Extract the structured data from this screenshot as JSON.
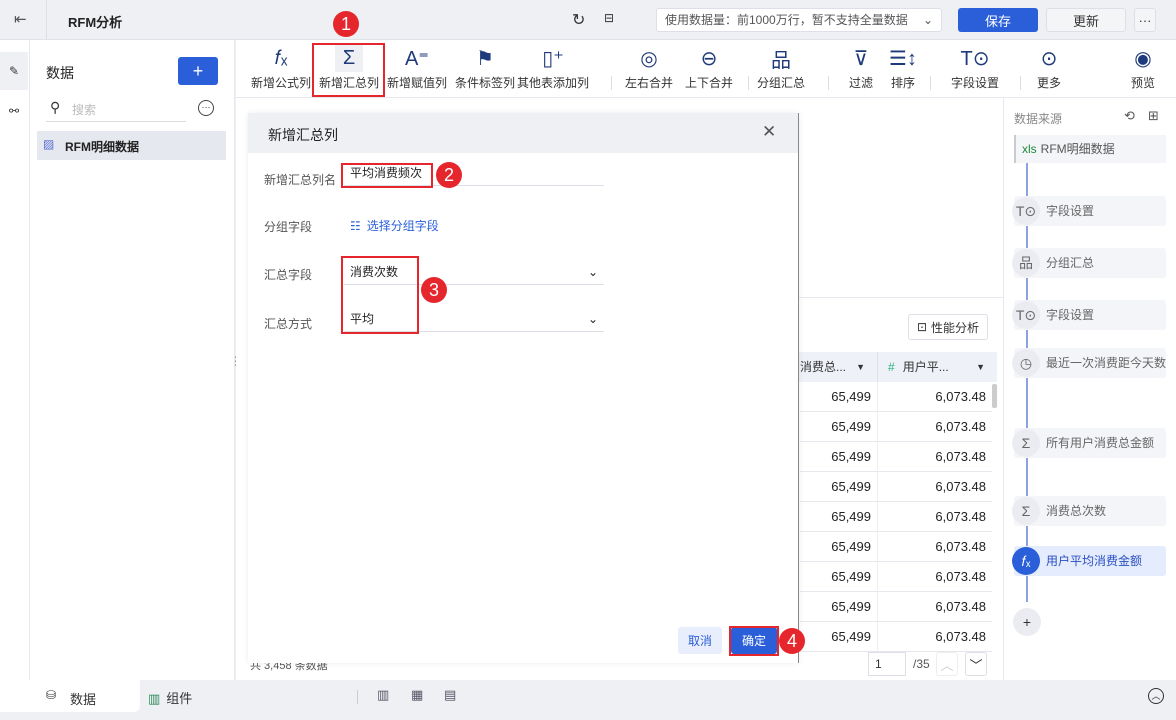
{
  "header": {
    "title": "RFM分析",
    "data_limit": "使用数据量：前1000万行，暂不支持全量数据",
    "save": "保存",
    "update": "更新",
    "more": "···"
  },
  "sidebar": {
    "title": "数据",
    "add": "+",
    "search_placeholder": "搜索",
    "items": [
      {
        "label": "RFM明细数据"
      }
    ]
  },
  "toolbar": {
    "items": [
      {
        "label": "新增公式列",
        "icon": "fx-icon"
      },
      {
        "label": "新增汇总列",
        "icon": "sigma-icon"
      },
      {
        "label": "新增赋值列",
        "icon": "assign-icon"
      },
      {
        "label": "条件标签列",
        "icon": "flag-icon"
      },
      {
        "label": "其他表添加列",
        "icon": "add-column-icon"
      },
      {
        "label": "左右合并",
        "icon": "merge-lr-icon"
      },
      {
        "label": "上下合并",
        "icon": "merge-tb-icon"
      },
      {
        "label": "分组汇总",
        "icon": "group-icon"
      },
      {
        "label": "过滤",
        "icon": "filter-icon"
      },
      {
        "label": "排序",
        "icon": "sort-icon"
      },
      {
        "label": "字段设置",
        "icon": "field-settings-icon"
      },
      {
        "label": "更多",
        "icon": "more-icon"
      },
      {
        "label": "预览",
        "icon": "preview-icon"
      }
    ]
  },
  "dialog": {
    "title": "新增汇总列",
    "name_label": "新增汇总列名",
    "name_value": "平均消费频次",
    "group_label": "分组字段",
    "group_link": "选择分组字段",
    "sum_field_label": "汇总字段",
    "sum_field_value": "消费次数",
    "method_label": "汇总方式",
    "method_value": "平均",
    "cancel": "取消",
    "ok": "确定"
  },
  "annotations": [
    "1",
    "2",
    "3",
    "4"
  ],
  "table": {
    "perf_button": "性能分析",
    "columns": [
      "消费总...",
      "用户平..."
    ],
    "rows": [
      [
        "65,499",
        "6,073.48"
      ],
      [
        "65,499",
        "6,073.48"
      ],
      [
        "65,499",
        "6,073.48"
      ],
      [
        "65,499",
        "6,073.48"
      ],
      [
        "65,499",
        "6,073.48"
      ],
      [
        "65,499",
        "6,073.48"
      ],
      [
        "65,499",
        "6,073.48"
      ],
      [
        "65,499",
        "6,073.48"
      ],
      [
        "65,499",
        "6,073.48"
      ]
    ],
    "footer": "共 3,458 条数据",
    "page": "1",
    "total_pages": "/35"
  },
  "flow": {
    "title": "数据来源",
    "source": "RFM明细数据",
    "source_tag": "xls",
    "steps": [
      {
        "label": "字段设置",
        "icon": "field-settings-icon"
      },
      {
        "label": "分组汇总",
        "icon": "group-icon"
      },
      {
        "label": "字段设置",
        "icon": "field-settings-icon"
      },
      {
        "label": "最近一次消费距今天数",
        "icon": "clock-icon"
      },
      {
        "label": "所有用户消费总金额",
        "icon": "sigma-icon"
      },
      {
        "label": "消费总次数",
        "icon": "sigma-icon"
      },
      {
        "label": "用户平均消费金额",
        "icon": "fx-icon"
      }
    ],
    "add": "+"
  },
  "bottom": {
    "tabs": [
      "数据",
      "组件"
    ]
  },
  "colors": {
    "primary": "#2a5fd9",
    "annotation": "#e5262c"
  }
}
